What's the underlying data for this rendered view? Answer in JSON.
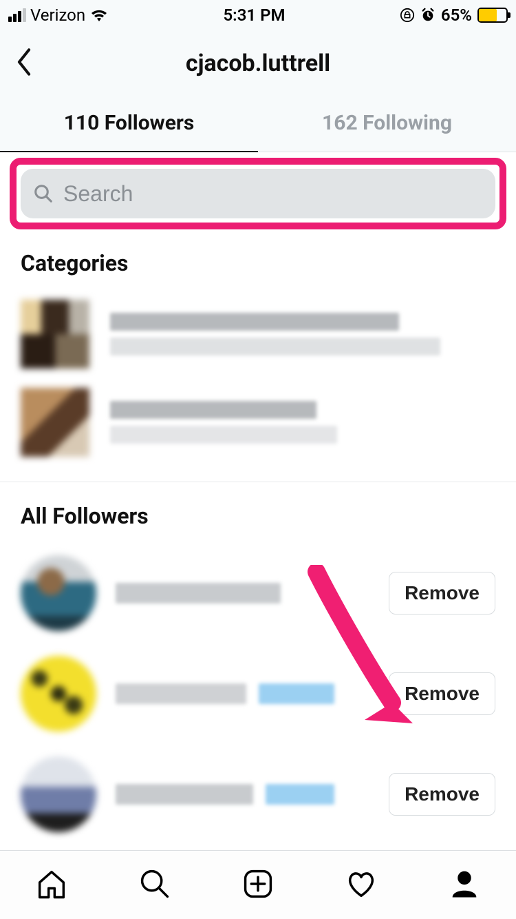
{
  "status": {
    "carrier": "Verizon",
    "time": "5:31 PM",
    "battery_pct": "65%",
    "battery_color": "#ffcc00"
  },
  "header": {
    "username": "cjacob.luttrell"
  },
  "tabs": {
    "followers_count": 110,
    "followers_label": "110 Followers",
    "following_count": 162,
    "following_label": "162 Following",
    "active": "followers"
  },
  "search": {
    "placeholder": "Search",
    "value": ""
  },
  "sections": {
    "categories_title": "Categories",
    "all_followers_title": "All Followers"
  },
  "buttons": {
    "remove": "Remove"
  },
  "annotation": {
    "highlight_color": "#ec1d72",
    "arrow_color": "#f01f72"
  }
}
